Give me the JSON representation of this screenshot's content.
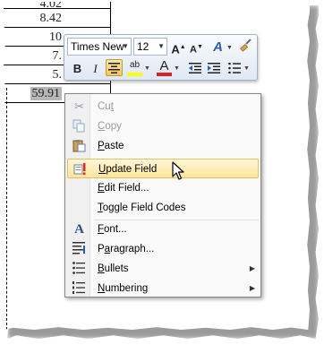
{
  "document": {
    "table_values": [
      "4.02",
      "8.42",
      "10",
      "7.",
      "5.",
      "59.91"
    ]
  },
  "mini_toolbar": {
    "font_name": "Times New",
    "font_size": "12",
    "grow_font_label": "A",
    "shrink_font_label": "A",
    "styles_label": "A",
    "bold_label": "B",
    "italic_label": "I",
    "highlight_label": "ab",
    "font_color_label": "A",
    "highlight_color": "#ffff00",
    "font_color": "#e02020"
  },
  "context_menu": {
    "items": [
      {
        "label": "Cut",
        "accel": "t",
        "icon": "scissors-icon",
        "disabled": true
      },
      {
        "label": "Copy",
        "accel": "C",
        "icon": "copy-icon",
        "disabled": true
      },
      {
        "label": "Paste",
        "accel": "P",
        "icon": "paste-icon",
        "disabled": false
      },
      {
        "label": "Update Field",
        "accel": "U",
        "icon": "update-field-icon",
        "disabled": false
      },
      {
        "label": "Edit Field...",
        "accel": "E",
        "icon": "",
        "disabled": false
      },
      {
        "label": "Toggle Field Codes",
        "accel": "T",
        "icon": "",
        "disabled": false
      },
      {
        "label": "Font...",
        "accel": "F",
        "icon": "font-icon",
        "disabled": false
      },
      {
        "label": "Paragraph...",
        "accel": "a",
        "icon": "paragraph-icon",
        "disabled": false
      },
      {
        "label": "Bullets",
        "accel": "B",
        "icon": "bullets-icon",
        "disabled": false
      },
      {
        "label": "Numbering",
        "accel": "N",
        "icon": "numbering-icon",
        "disabled": false
      }
    ]
  }
}
